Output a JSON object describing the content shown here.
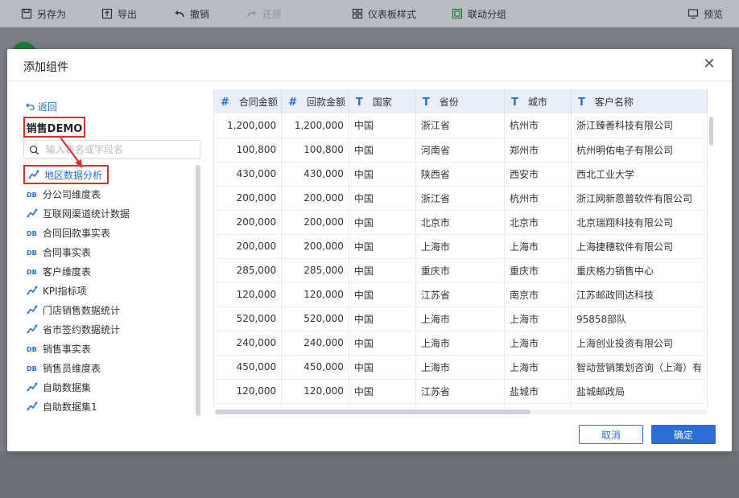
{
  "toolbar": {
    "save_as": "另存为",
    "export": "导出",
    "undo": "撤销",
    "redo": "还原",
    "dashboard_style": "仪表板样式",
    "linked_groups": "联动分组",
    "preview": "预览"
  },
  "modal": {
    "title": "添加组件",
    "back": "返回",
    "package_name": "销售DEMO",
    "search_placeholder": "输入表名或字段名",
    "cancel": "取消",
    "confirm": "确定"
  },
  "tables": [
    {
      "label": "地区数据分析",
      "icon": "analysis-icon",
      "selected": true
    },
    {
      "label": "分公司维度表",
      "icon": "db-table-icon",
      "selected": false
    },
    {
      "label": "互联网渠道统计数据",
      "icon": "analysis-icon",
      "selected": false
    },
    {
      "label": "合同回款事实表",
      "icon": "db-table-icon",
      "selected": false
    },
    {
      "label": "合同事实表",
      "icon": "db-table-icon",
      "selected": false
    },
    {
      "label": "客户维度表",
      "icon": "db-table-icon",
      "selected": false
    },
    {
      "label": "KPI指标项",
      "icon": "analysis-icon",
      "selected": false
    },
    {
      "label": "门店销售数据统计",
      "icon": "analysis-icon",
      "selected": false
    },
    {
      "label": "省市签约数据统计",
      "icon": "analysis-icon",
      "selected": false
    },
    {
      "label": "销售事实表",
      "icon": "db-table-icon",
      "selected": false
    },
    {
      "label": "销售员维度表",
      "icon": "db-table-icon",
      "selected": false
    },
    {
      "label": "自助数据集",
      "icon": "analysis-icon",
      "selected": false
    },
    {
      "label": "自助数据集1",
      "icon": "analysis-icon",
      "selected": false
    }
  ],
  "grid": {
    "columns": [
      {
        "type": "#",
        "label": "合同金额"
      },
      {
        "type": "#",
        "label": "回款金额"
      },
      {
        "type": "T",
        "label": "国家"
      },
      {
        "type": "T",
        "label": "省份"
      },
      {
        "type": "T",
        "label": "城市"
      },
      {
        "type": "T",
        "label": "客户名称"
      }
    ],
    "rows": [
      [
        "1,200,000",
        "1,200,000",
        "中国",
        "浙江省",
        "杭州市",
        "浙江臻善科技有限公司"
      ],
      [
        "100,800",
        "100,800",
        "中国",
        "河南省",
        "郑州市",
        "杭州明佑电子有限公司"
      ],
      [
        "430,000",
        "430,000",
        "中国",
        "陕西省",
        "西安市",
        "西北工业大学"
      ],
      [
        "200,000",
        "200,000",
        "中国",
        "浙江省",
        "杭州市",
        "浙江网新恩普软件有限公司"
      ],
      [
        "200,000",
        "200,000",
        "中国",
        "北京市",
        "北京市",
        "北京瑞翔科技有限公司"
      ],
      [
        "200,000",
        "200,000",
        "中国",
        "上海市",
        "上海市",
        "上海捷穗软件有限公司"
      ],
      [
        "285,000",
        "285,000",
        "中国",
        "重庆市",
        "重庆市",
        "重庆格力销售中心"
      ],
      [
        "120,000",
        "120,000",
        "中国",
        "江苏省",
        "南京市",
        "江苏邮政同达科技"
      ],
      [
        "520,000",
        "520,000",
        "中国",
        "上海市",
        "上海市",
        "95858部队"
      ],
      [
        "240,000",
        "240,000",
        "中国",
        "上海市",
        "上海市",
        "上海创业投资有限公司"
      ],
      [
        "450,000",
        "450,000",
        "中国",
        "上海市",
        "上海市",
        "智动营销策划咨询（上海）有"
      ],
      [
        "120,000",
        "120,000",
        "中国",
        "江苏省",
        "盐城市",
        "盐城邮政局"
      ],
      [
        "",
        "",
        "",
        "",
        "",
        ""
      ]
    ]
  },
  "colors": {
    "accent": "#2b6fd6",
    "annotation_red": "#e6292e",
    "header_bg": "#e9eef7"
  }
}
